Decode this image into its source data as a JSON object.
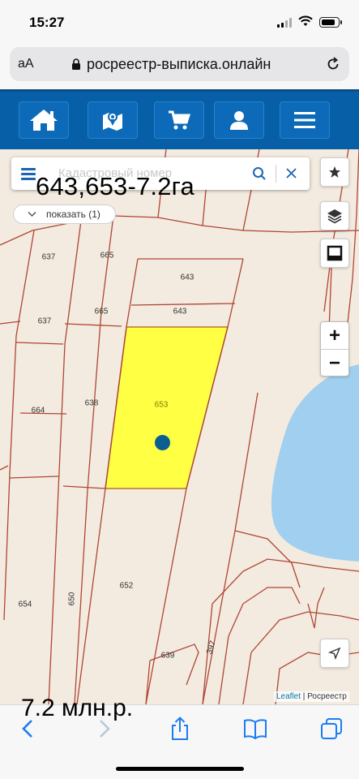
{
  "status_bar": {
    "time": "15:27",
    "battery_level": 0.85
  },
  "browser": {
    "text_size_label": "aA",
    "url": "росреестр-выписка.онлайн"
  },
  "site_nav": {
    "items": [
      {
        "name": "home",
        "icon": "home-icon"
      },
      {
        "name": "map",
        "icon": "map-icon"
      },
      {
        "name": "cart",
        "icon": "cart-icon"
      },
      {
        "name": "account",
        "icon": "user-icon"
      },
      {
        "name": "menu",
        "icon": "hamburger-icon"
      }
    ],
    "accent_color": "#075fa8"
  },
  "map": {
    "search_placeholder": "Кадастровый номер",
    "overlay_title": "643,653-7.2га",
    "show_chip_label": "показать (1)",
    "highlight_color": "#ffff44",
    "water_color": "#a0cff0",
    "parcel_labels": [
      {
        "id": "p637a",
        "text": "637"
      },
      {
        "id": "p665a",
        "text": "665"
      },
      {
        "id": "p643a",
        "text": "643"
      },
      {
        "id": "p637b",
        "text": "637"
      },
      {
        "id": "p665b",
        "text": "665"
      },
      {
        "id": "p643b",
        "text": "643"
      },
      {
        "id": "p664",
        "text": "664"
      },
      {
        "id": "p638",
        "text": "638"
      },
      {
        "id": "p653",
        "text": "653"
      },
      {
        "id": "p650",
        "text": "650"
      },
      {
        "id": "p652",
        "text": "652"
      },
      {
        "id": "p654",
        "text": "654"
      },
      {
        "id": "p639",
        "text": "639"
      },
      {
        "id": "p397",
        "text": "397"
      }
    ],
    "attribution_leaflet": "Leaflet",
    "attribution_sep": " | ",
    "attribution_source": "Росреестр",
    "zoom_in": "+",
    "zoom_out": "−"
  },
  "price_overlay": "7.2 млн.р.",
  "toolbar": {
    "items": [
      "back-icon",
      "forward-icon",
      "share-icon",
      "bookmarks-icon",
      "tabs-icon"
    ]
  }
}
